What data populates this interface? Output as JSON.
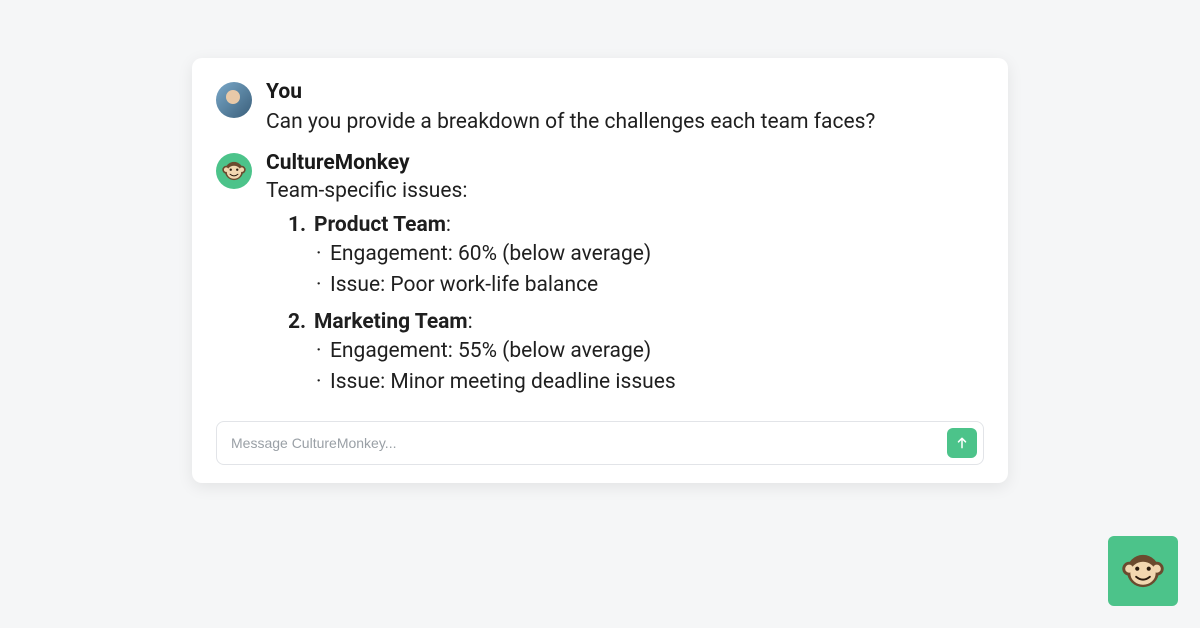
{
  "chat": {
    "user": {
      "author": "You",
      "text": "Can you provide a breakdown of the challenges each team faces?"
    },
    "bot": {
      "author": "CultureMonkey",
      "heading": "Team-specific issues:",
      "teams": [
        {
          "num": "1.",
          "name": "Product Team",
          "bullets": [
            "Engagement: 60% (below average)",
            "Issue: Poor work-life balance"
          ]
        },
        {
          "num": "2.",
          "name": "Marketing Team",
          "bullets": [
            "Engagement: 55% (below average)",
            "Issue: Minor meeting deadline issues"
          ]
        }
      ]
    }
  },
  "input": {
    "placeholder": "Message CultureMonkey..."
  },
  "colors": {
    "accent": "#4cc38a"
  }
}
